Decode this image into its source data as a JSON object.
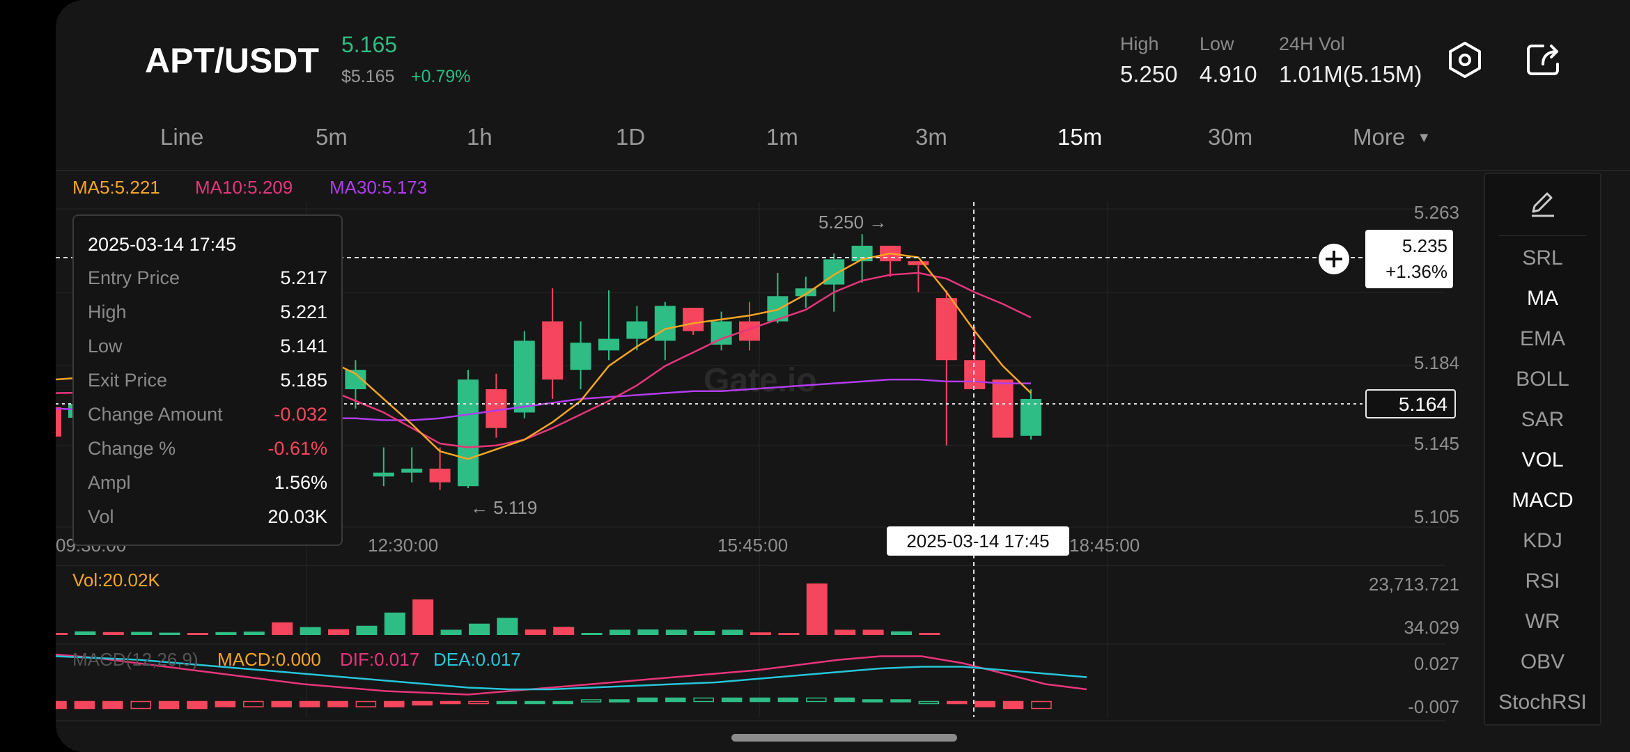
{
  "header": {
    "pair": "APT/USDT",
    "last_price": "5.165",
    "usd_price": "$5.165",
    "change_pct": "+0.79%",
    "stats": [
      {
        "label": "High",
        "value": "5.250"
      },
      {
        "label": "Low",
        "value": "4.910"
      },
      {
        "label": "24H Vol",
        "value": "1.01M(5.15M)"
      }
    ],
    "icons": [
      "settings-hex-icon",
      "share-icon"
    ]
  },
  "tabs": [
    "Line",
    "5m",
    "1h",
    "1D",
    "1m",
    "3m",
    "15m",
    "30m",
    "More"
  ],
  "active_tab": "15m",
  "ma_legend": {
    "ma5": "MA5:5.221",
    "ma10": "MA10:5.209",
    "ma30": "MA30:5.173"
  },
  "price_axis": [
    "5.263",
    "5.184",
    "5.145",
    "5.105"
  ],
  "time_axis": [
    "09:30:00",
    "12:30:00",
    "15:45:00",
    "18:45:00"
  ],
  "markers": {
    "high_label": "5.250 →",
    "low_label": "← 5.119"
  },
  "crosshair": {
    "price": "5.235",
    "pct": "+1.36%",
    "time": "2025-03-14 17:45"
  },
  "current_price_box": "5.164",
  "watermark": "Gate.io",
  "tooltip": {
    "date": "2025-03-14 17:45",
    "rows": [
      {
        "k": "Entry Price",
        "v": "5.217"
      },
      {
        "k": "High",
        "v": "5.221"
      },
      {
        "k": "Low",
        "v": "5.141"
      },
      {
        "k": "Exit Price",
        "v": "5.185"
      },
      {
        "k": "Change Amount",
        "v": "-0.032"
      },
      {
        "k": "Change %",
        "v": "-0.61%"
      },
      {
        "k": "Ampl",
        "v": "1.56%"
      },
      {
        "k": "Vol",
        "v": "20.03K"
      }
    ]
  },
  "volume": {
    "label": "Vol:20.02K",
    "axis_top": "23,713.721",
    "axis_bottom": "34.029"
  },
  "macd": {
    "label": "MACD(12,26,9)",
    "macd": "MACD:0.000",
    "dif": "DIF:0.017",
    "dea": "DEA:0.017",
    "axis_top": "0.027",
    "axis_bottom": "-0.007"
  },
  "indicators": [
    "SRL",
    "MA",
    "EMA",
    "BOLL",
    "SAR",
    "VOL",
    "MACD",
    "KDJ",
    "RSI",
    "WR",
    "OBV",
    "StochRSI"
  ],
  "active_indicators": [
    "MA",
    "VOL",
    "MACD"
  ],
  "colors": {
    "up": "#2ebd85",
    "down": "#f6465d",
    "ma5": "#f5a623",
    "ma10": "#e8357a",
    "ma30": "#b13cf0",
    "dif": "#e8357a",
    "dea": "#26c6da"
  },
  "chart_data": {
    "type": "candlestick",
    "price_range": [
      5.105,
      5.263
    ],
    "candles": [
      {
        "o": 5.18,
        "h": 5.185,
        "l": 5.16,
        "c": 5.165
      },
      {
        "o": 5.17,
        "h": 5.185,
        "l": 5.16,
        "c": 5.18
      },
      {
        "o": 5.125,
        "h": 5.14,
        "l": 5.12,
        "c": 5.127
      },
      {
        "o": 5.127,
        "h": 5.14,
        "l": 5.122,
        "c": 5.129
      },
      {
        "o": 5.129,
        "h": 5.14,
        "l": 5.118,
        "c": 5.122
      },
      {
        "o": 5.12,
        "h": 5.18,
        "l": 5.119,
        "c": 5.175
      },
      {
        "o": 5.17,
        "h": 5.178,
        "l": 5.145,
        "c": 5.15
      },
      {
        "o": 5.158,
        "h": 5.2,
        "l": 5.155,
        "c": 5.195
      },
      {
        "o": 5.205,
        "h": 5.222,
        "l": 5.165,
        "c": 5.175
      },
      {
        "o": 5.18,
        "h": 5.205,
        "l": 5.17,
        "c": 5.194
      },
      {
        "o": 5.19,
        "h": 5.221,
        "l": 5.185,
        "c": 5.196
      },
      {
        "o": 5.196,
        "h": 5.213,
        "l": 5.19,
        "c": 5.205
      },
      {
        "o": 5.195,
        "h": 5.215,
        "l": 5.185,
        "c": 5.213
      },
      {
        "o": 5.212,
        "h": 5.212,
        "l": 5.198,
        "c": 5.2
      },
      {
        "o": 5.193,
        "h": 5.21,
        "l": 5.19,
        "c": 5.205
      },
      {
        "o": 5.205,
        "h": 5.215,
        "l": 5.19,
        "c": 5.195
      },
      {
        "o": 5.205,
        "h": 5.23,
        "l": 5.204,
        "c": 5.218
      },
      {
        "o": 5.218,
        "h": 5.228,
        "l": 5.212,
        "c": 5.222
      },
      {
        "o": 5.224,
        "h": 5.24,
        "l": 5.21,
        "c": 5.237
      },
      {
        "o": 5.236,
        "h": 5.25,
        "l": 5.225,
        "c": 5.244
      },
      {
        "o": 5.244,
        "h": 5.238,
        "l": 5.228,
        "c": 5.236
      },
      {
        "o": 5.236,
        "h": 5.236,
        "l": 5.22,
        "c": 5.234
      },
      {
        "o": 5.217,
        "h": 5.221,
        "l": 5.141,
        "c": 5.185
      },
      {
        "o": 5.185,
        "h": 5.202,
        "l": 5.17,
        "c": 5.17
      },
      {
        "o": 5.175,
        "h": 5.175,
        "l": 5.145,
        "c": 5.145
      },
      {
        "o": 5.146,
        "h": 5.17,
        "l": 5.144,
        "c": 5.165
      }
    ],
    "ma5": [
      5.185,
      5.178,
      5.165,
      5.152,
      5.138,
      5.134,
      5.139,
      5.144,
      5.153,
      5.164,
      5.182,
      5.192,
      5.201,
      5.204,
      5.206,
      5.208,
      5.211,
      5.219,
      5.229,
      5.237,
      5.24,
      5.238,
      5.22,
      5.2,
      5.182,
      5.168
    ],
    "ma10": [
      5.17,
      5.164,
      5.158,
      5.15,
      5.142,
      5.14,
      5.141,
      5.144,
      5.15,
      5.157,
      5.164,
      5.172,
      5.182,
      5.189,
      5.196,
      5.201,
      5.206,
      5.211,
      5.22,
      5.226,
      5.229,
      5.23,
      5.227,
      5.22,
      5.214,
      5.207
    ],
    "ma30": [
      5.155,
      5.155,
      5.154,
      5.154,
      5.155,
      5.157,
      5.159,
      5.161,
      5.163,
      5.165,
      5.166,
      5.167,
      5.168,
      5.169,
      5.169,
      5.17,
      5.171,
      5.172,
      5.173,
      5.174,
      5.175,
      5.175,
      5.174,
      5.174,
      5.173,
      5.173
    ],
    "volume_range": [
      0,
      23713.721
    ],
    "volume": [
      800,
      1400,
      1100,
      1200,
      900,
      300,
      1100,
      1300,
      4800,
      3000,
      2200,
      3500,
      8500,
      13500,
      2000,
      4300,
      6500,
      2100,
      3100,
      800,
      2000,
      2100,
      2000,
      1600,
      2000,
      1000,
      600,
      19500,
      2000,
      2000,
      1400,
      800
    ],
    "volume_up": [
      false,
      true,
      false,
      true,
      true,
      false,
      true,
      true,
      false,
      true,
      false,
      true,
      true,
      false,
      true,
      true,
      true,
      false,
      false,
      true,
      true,
      true,
      true,
      true,
      true,
      false,
      false,
      false,
      false,
      false,
      true,
      false
    ],
    "macd_range": [
      -0.007,
      0.027
    ],
    "macd_hist": [
      -0.004,
      -0.004,
      -0.004,
      -0.004,
      -0.004,
      -0.004,
      -0.003,
      -0.003,
      -0.003,
      -0.003,
      -0.003,
      -0.003,
      -0.003,
      -0.002,
      -0.001,
      -0.001,
      0.0,
      0.0,
      0.0,
      0.001,
      0.001,
      0.002,
      0.002,
      0.002,
      0.002,
      0.002,
      0.002,
      0.002,
      0.002,
      0.001,
      0.001,
      0.0,
      -0.001,
      -0.003,
      -0.004,
      -0.004
    ],
    "dif": [
      0.027,
      0.025,
      0.022,
      0.019,
      0.016,
      0.013,
      0.01,
      0.008,
      0.006,
      0.005,
      0.004,
      0.006,
      0.008,
      0.01,
      0.012,
      0.014,
      0.016,
      0.018,
      0.021,
      0.024,
      0.026,
      0.026,
      0.022,
      0.016,
      0.01,
      0.007
    ],
    "dea": [
      0.026,
      0.025,
      0.024,
      0.022,
      0.02,
      0.018,
      0.016,
      0.014,
      0.012,
      0.01,
      0.008,
      0.007,
      0.007,
      0.008,
      0.009,
      0.01,
      0.011,
      0.013,
      0.015,
      0.017,
      0.019,
      0.02,
      0.02,
      0.018,
      0.016,
      0.014
    ]
  }
}
